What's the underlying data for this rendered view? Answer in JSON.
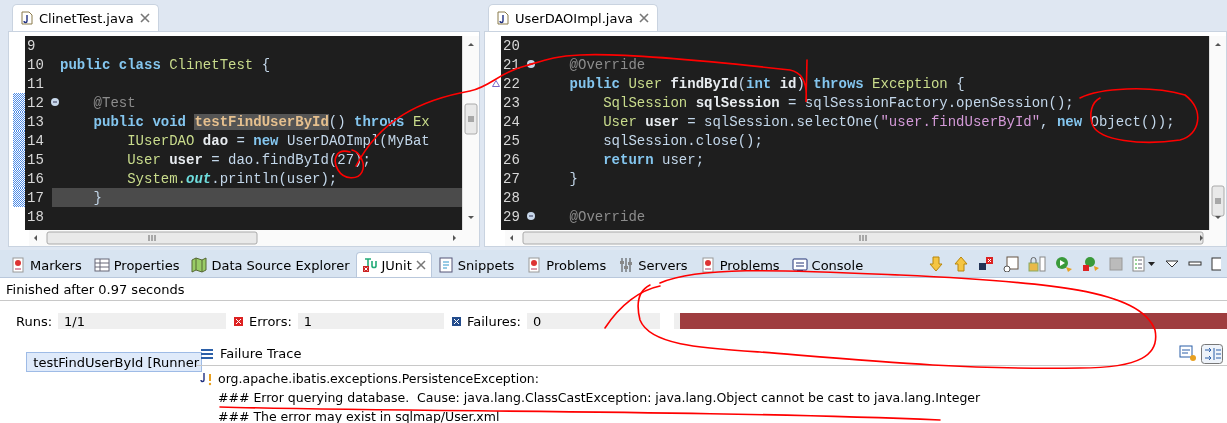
{
  "editors": [
    {
      "title": "ClinetTest.java",
      "lines": [
        {
          "number": "9"
        },
        {
          "number": "10",
          "tokens": [
            {
              "kind": "kw",
              "text": "public class "
            },
            {
              "kind": "type",
              "text": "ClinetTest"
            },
            {
              "kind": "plain",
              "text": " {"
            }
          ]
        },
        {
          "number": "11"
        },
        {
          "number": "12",
          "fold": true,
          "range": true,
          "tokens": [
            {
              "kind": "ann",
              "text": "    @Test"
            }
          ]
        },
        {
          "number": "13",
          "range": true,
          "tokens": [
            {
              "kind": "kw",
              "text": "    public void "
            },
            {
              "kind": "mark",
              "text": "testFindUserById"
            },
            {
              "kind": "plain",
              "text": "() "
            },
            {
              "kind": "kw",
              "text": "throws "
            },
            {
              "kind": "type",
              "text": "Ex"
            }
          ]
        },
        {
          "number": "14",
          "range": true,
          "tokens": [
            {
              "kind": "type",
              "text": "        IUserDAO "
            },
            {
              "kind": "var",
              "text": "dao"
            },
            {
              "kind": "plain",
              "text": " = "
            },
            {
              "kind": "kw",
              "text": "new "
            },
            {
              "kind": "plain",
              "text": "UserDAOImpl(MyBat"
            }
          ]
        },
        {
          "number": "15",
          "range": true,
          "tokens": [
            {
              "kind": "type",
              "text": "        User "
            },
            {
              "kind": "var",
              "text": "user"
            },
            {
              "kind": "plain",
              "text": " = dao.findById(27);"
            }
          ]
        },
        {
          "number": "16",
          "range": true,
          "tokens": [
            {
              "kind": "type",
              "text": "        System."
            },
            {
              "kind": "field",
              "text": "out"
            },
            {
              "kind": "plain",
              "text": ".println(user);"
            }
          ]
        },
        {
          "number": "17",
          "range": true,
          "current": true,
          "tokens": [
            {
              "kind": "plain",
              "text": "    }"
            }
          ]
        },
        {
          "number": "18"
        }
      ]
    },
    {
      "title": "UserDAOImpl.java",
      "lines": [
        {
          "number": "20"
        },
        {
          "number": "21",
          "fold": true,
          "tokens": [
            {
              "kind": "ann",
              "text": "    @Override"
            }
          ]
        },
        {
          "number": "22",
          "override": true,
          "tokens": [
            {
              "kind": "kw",
              "text": "    public "
            },
            {
              "kind": "type",
              "text": "User "
            },
            {
              "kind": "var",
              "text": "findById"
            },
            {
              "kind": "plain",
              "text": "("
            },
            {
              "kind": "kw",
              "text": "int "
            },
            {
              "kind": "var",
              "text": "id"
            },
            {
              "kind": "plain",
              "text": ") "
            },
            {
              "kind": "kw",
              "text": "throws "
            },
            {
              "kind": "type",
              "text": "Exception"
            },
            {
              "kind": "plain",
              "text": " {"
            }
          ]
        },
        {
          "number": "23",
          "tokens": [
            {
              "kind": "type",
              "text": "        SqlSession "
            },
            {
              "kind": "var",
              "text": "sqlSession"
            },
            {
              "kind": "plain",
              "text": " = sqlSessionFactory.openSession();"
            }
          ]
        },
        {
          "number": "24",
          "tokens": [
            {
              "kind": "type",
              "text": "        User "
            },
            {
              "kind": "var",
              "text": "user"
            },
            {
              "kind": "plain",
              "text": " = sqlSession.selectOne("
            },
            {
              "kind": "str",
              "text": "\"user.findUserById\""
            },
            {
              "kind": "plain",
              "text": ", "
            },
            {
              "kind": "kw",
              "text": "new "
            },
            {
              "kind": "plain",
              "text": "Object());"
            }
          ]
        },
        {
          "number": "25",
          "tokens": [
            {
              "kind": "plain",
              "text": "        sqlSession.close();"
            }
          ]
        },
        {
          "number": "26",
          "tokens": [
            {
              "kind": "kw",
              "text": "        return "
            },
            {
              "kind": "plain",
              "text": "user;"
            }
          ]
        },
        {
          "number": "27",
          "tokens": [
            {
              "kind": "plain",
              "text": "    }"
            }
          ]
        },
        {
          "number": "28"
        },
        {
          "number": "29",
          "fold": true,
          "tokens": [
            {
              "kind": "ann",
              "text": "    @Override"
            }
          ]
        }
      ]
    }
  ],
  "view_tabs": [
    {
      "label": "Markers",
      "selected": false
    },
    {
      "label": "Properties",
      "selected": false
    },
    {
      "label": "Data Source Explorer",
      "selected": false
    },
    {
      "label": "JUnit",
      "selected": true
    },
    {
      "label": "Snippets",
      "selected": false
    },
    {
      "label": "Problems",
      "selected": false
    },
    {
      "label": "Servers",
      "selected": false
    },
    {
      "label": "Problems",
      "selected": false
    },
    {
      "label": "Console",
      "selected": false
    }
  ],
  "junit": {
    "status": "Finished after 0.97 seconds",
    "counters": [
      {
        "kind": "runs",
        "label": "Runs:",
        "value": "1/1"
      },
      {
        "kind": "errors",
        "label": "Errors:",
        "value": "1"
      },
      {
        "kind": "failures",
        "label": "Failures:",
        "value": "0"
      }
    ],
    "progress": {
      "level": 1,
      "failed": true
    },
    "tests": [
      {
        "label": "testFindUserById [Runner",
        "selected": true
      }
    ],
    "trace_title": "Failure Trace",
    "trace": [
      "org.apache.ibatis.exceptions.PersistenceException: ",
      "### Error querying database.  Cause: java.lang.ClassCastException: java.lang.Object cannot be cast to java.lang.Integer",
      "### The error may exist in sqlmap/User.xml"
    ]
  }
}
